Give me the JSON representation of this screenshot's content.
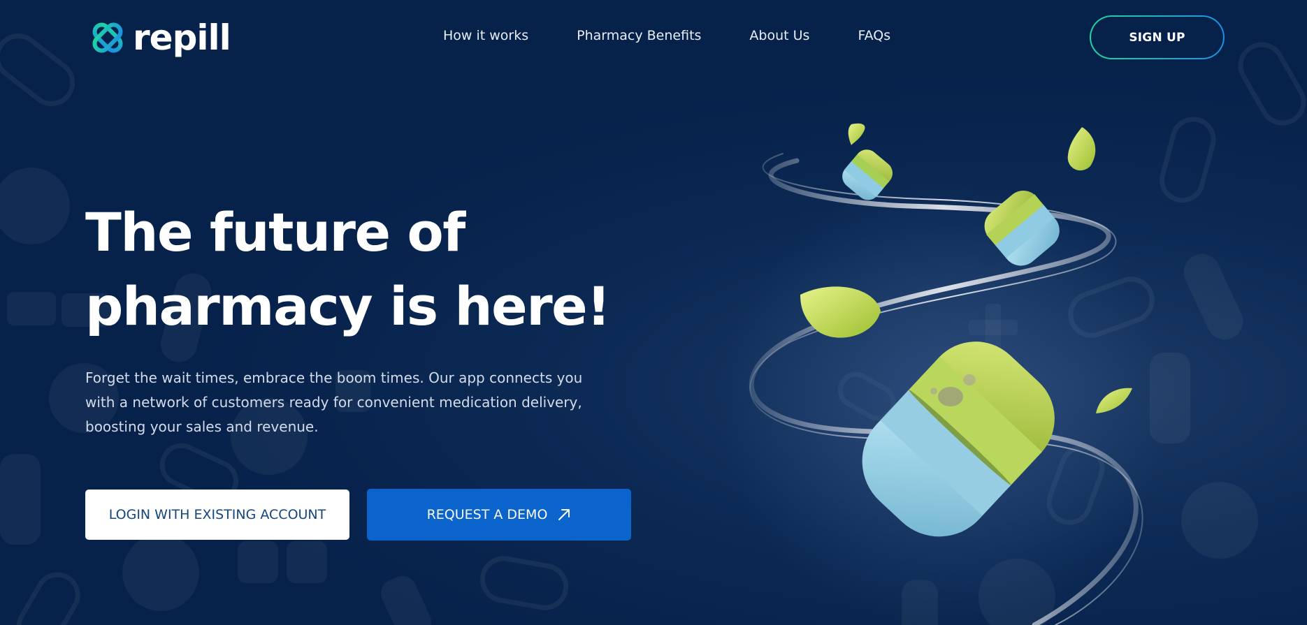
{
  "brand": {
    "name": "repill",
    "colors": {
      "background": "#06214a",
      "accent_green": "#1fd6a0",
      "accent_blue": "#1b8fe8",
      "button_blue": "#0b63cc",
      "login_text": "#14467e"
    }
  },
  "nav": {
    "items": [
      {
        "label": "How it works"
      },
      {
        "label": "Pharmacy Benefits"
      },
      {
        "label": "About Us"
      },
      {
        "label": "FAQs"
      }
    ],
    "signup_label": "SIGN UP"
  },
  "hero": {
    "title_line1": "The future of",
    "title_line2": "pharmacy is here!",
    "description": "Forget the wait times, embrace the boom times. Our app connects you with a network of customers ready for convenient medication delivery, boosting your sales and revenue.",
    "login_button": "LOGIN WITH EXISTING ACCOUNT",
    "demo_button": "REQUEST A DEMO",
    "demo_icon": "arrow-up-right-icon"
  },
  "icons": {
    "logo": "repill-logo-icon",
    "background": "pill-pattern",
    "illustration": "capsule-illustration"
  }
}
